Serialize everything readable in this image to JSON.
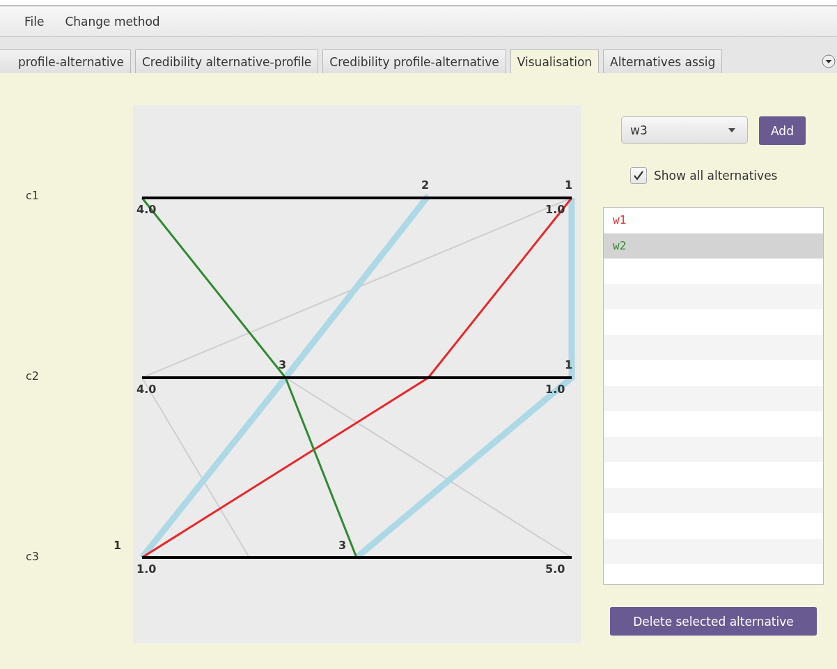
{
  "menu": [
    "File",
    "Change method"
  ],
  "tabs": [
    {
      "label": "profile-alternative",
      "selected": false
    },
    {
      "label": "Credibility alternative-profile",
      "selected": false
    },
    {
      "label": "Credibility profile-alternative",
      "selected": false
    },
    {
      "label": "Visualisation",
      "selected": true
    },
    {
      "label": "Alternatives assig",
      "selected": false
    }
  ],
  "criteria": [
    {
      "label": "c1",
      "left_value": "4.0",
      "right_value": "1.0",
      "marks": [
        "2",
        "1"
      ]
    },
    {
      "label": "c2",
      "left_value": "4.0",
      "right_value": "1.0",
      "marks": [
        "3",
        "1"
      ]
    },
    {
      "label": "c3",
      "left_value": "1.0",
      "right_value": "5.0",
      "marks": [
        "1",
        "3"
      ]
    }
  ],
  "alternative_select": {
    "value": "w3"
  },
  "add_button": "Add",
  "show_all": {
    "label": "Show all alternatives",
    "checked": true
  },
  "alternatives": [
    {
      "name": "w1",
      "color": "#e8282b",
      "selected": false
    },
    {
      "name": "w2",
      "color": "#2e8b2e",
      "selected": true
    }
  ],
  "delete_button": "Delete selected alternative"
}
